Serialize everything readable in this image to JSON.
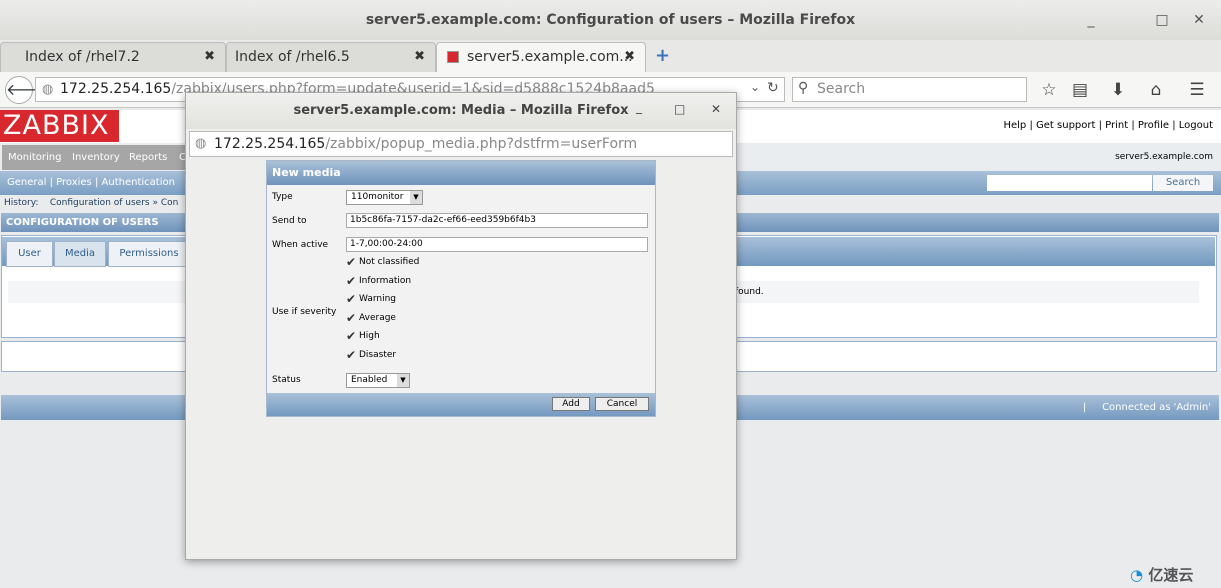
{
  "browser": {
    "window_title": "server5.example.com: Configuration of users – Mozilla Firefox",
    "tabs": [
      {
        "label": "Index of /rhel7.2"
      },
      {
        "label": "Index of /rhel6.5"
      },
      {
        "label": "server5.example.com..."
      }
    ],
    "url_host": "172.25.254.165",
    "url_path": "/zabbix/users.php?form=update&userid=1&sid=d5888c1524b8aad5",
    "search_placeholder": "Search"
  },
  "zabbix": {
    "logo": "ZABBIX",
    "top_links": [
      "Help",
      "Get support",
      "Print",
      "Profile",
      "Logout"
    ],
    "main_menu": [
      "Monitoring",
      "Inventory",
      "Reports",
      "C"
    ],
    "server_name": "server5.example.com",
    "sub_menu": [
      "General",
      "Proxies",
      "Authentication"
    ],
    "search_button": "Search",
    "history_label": "History:",
    "history_path": "Configuration of users » Con",
    "section_title": "CONFIGURATION OF USERS",
    "form_tabs": [
      "User",
      "Media",
      "Permissions"
    ],
    "no_data_text": "found.",
    "footer_text": "Connected as 'Admin'"
  },
  "popup": {
    "window_title": "server5.example.com: Media – Mozilla Firefox",
    "url_host": "172.25.254.165",
    "url_path": "/zabbix/popup_media.php?dstfrm=userForm",
    "form_title": "New media",
    "type_label": "Type",
    "type_value": "110monitor",
    "send_to_label": "Send to",
    "send_to_value": "1b5c86fa-7157-da2c-ef66-eed359b6f4b3",
    "when_active_label": "When active",
    "when_active_value": "1-7,00:00-24:00",
    "severity_label": "Use if severity",
    "severities": [
      {
        "label": "Not classified",
        "checked": true
      },
      {
        "label": "Information",
        "checked": true
      },
      {
        "label": "Warning",
        "checked": true
      },
      {
        "label": "Average",
        "checked": true
      },
      {
        "label": "High",
        "checked": true
      },
      {
        "label": "Disaster",
        "checked": true
      }
    ],
    "status_label": "Status",
    "status_value": "Enabled",
    "add_button": "Add",
    "cancel_button": "Cancel"
  },
  "watermark": "亿速云"
}
